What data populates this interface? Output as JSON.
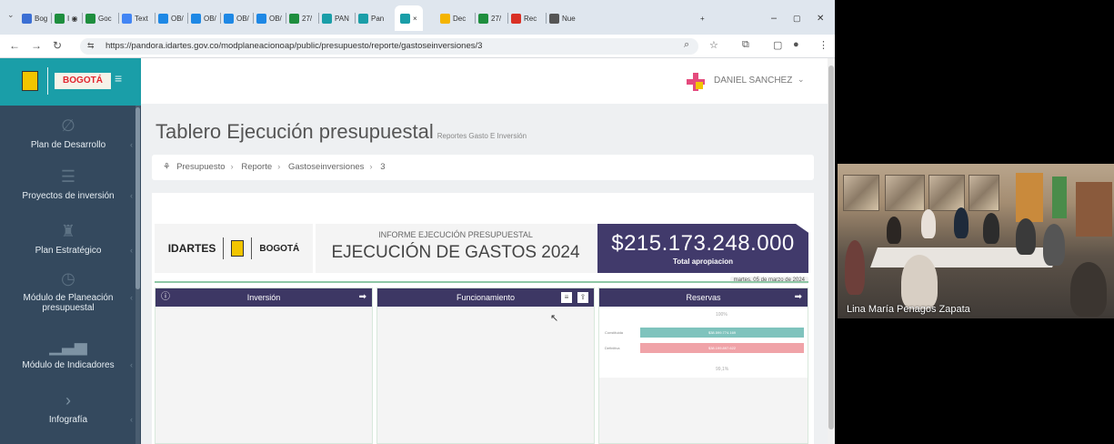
{
  "browser": {
    "tabs": [
      {
        "label": "Bog",
        "color": "#3b6fd4"
      },
      {
        "label": "I ◉",
        "color": "#1e8e3e"
      },
      {
        "label": "Goc",
        "color": "#1e8e3e"
      },
      {
        "label": "Text",
        "color": "#4285f4"
      },
      {
        "label": "OB/",
        "color": "#1e88e5"
      },
      {
        "label": "OB/",
        "color": "#1e88e5"
      },
      {
        "label": "OB/",
        "color": "#1e88e5"
      },
      {
        "label": "OB/",
        "color": "#1e88e5"
      },
      {
        "label": "27/",
        "color": "#1e8e3e"
      },
      {
        "label": "PAN",
        "color": "#1a9ea8"
      },
      {
        "label": "Pan",
        "color": "#1a9ea8"
      },
      {
        "label": "×",
        "color": "#1a9ea8"
      },
      {
        "label": "Dec",
        "color": "#f4b400"
      },
      {
        "label": "27/",
        "color": "#1e8e3e"
      },
      {
        "label": "Rec",
        "color": "#d93025"
      },
      {
        "label": "Nue",
        "color": "#555555"
      }
    ],
    "new_tab": "+",
    "win_min": "–",
    "win_max": "▢",
    "win_close": "✕",
    "url": "https://pandora.idartes.gov.co/modplaneacionoap/public/presupuesto/reporte/gastoseinversiones/3"
  },
  "header": {
    "brand": "BOGOTÁ",
    "user": "DANIEL SANCHEZ"
  },
  "sidebar": {
    "items": [
      {
        "label": "Plan de Desarrollo",
        "icon": "∅"
      },
      {
        "label": "Proyectos de inversión",
        "icon": "☰"
      },
      {
        "label": "Plan Estratégico",
        "icon": "♜"
      },
      {
        "label": "Módulo de Planeación presupuestal",
        "icon": "◷"
      },
      {
        "label": "Módulo de Indicadores",
        "icon": "▁▃▅"
      },
      {
        "label": "Infografía",
        "icon": "›"
      }
    ]
  },
  "page": {
    "title": "Tablero Ejecución presupuestal",
    "subtitle": "Reportes Gasto E Inversión",
    "breadcrumb": [
      "Presupuesto",
      "Reporte",
      "Gastoseinversiones",
      "3"
    ]
  },
  "report": {
    "logo_idartes": "IDARTES",
    "logo_bogota": "BOGOTÁ",
    "informe_label": "INFORME EJECUCIÓN PRESUPUESTAL",
    "main_title": "EJECUCIÓN DE GASTOS 2024",
    "total_amount": "$215.173.248.000",
    "total_label": "Total apropiacion",
    "date": "martes, 05 de marzo de 2024",
    "cards": [
      {
        "title": "Inversión"
      },
      {
        "title": "Funcionamiento"
      },
      {
        "title": "Reservas"
      }
    ],
    "reservas": {
      "top_pct": "100%",
      "bottom_pct": "99,1%",
      "rows": [
        {
          "label": "Constituida",
          "value": "$38.599.774.169",
          "color": "#7fc3bd"
        },
        {
          "label": "Definitiva",
          "value": "$38.199.897.622",
          "color": "#f0a3a8"
        }
      ]
    }
  },
  "video": {
    "participant": "Lina María Penagos Zapata"
  }
}
